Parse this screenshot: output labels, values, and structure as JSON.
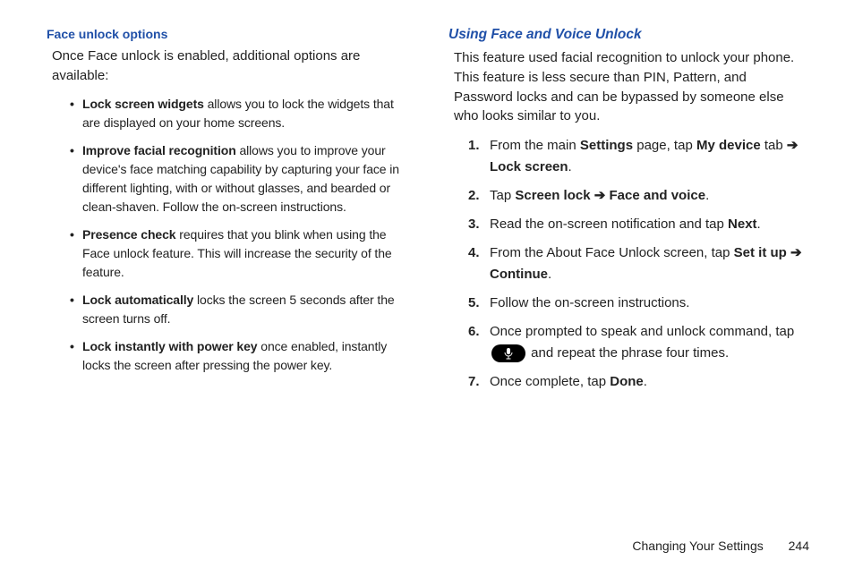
{
  "left": {
    "heading": "Face unlock options",
    "intro": "Once Face unlock is enabled, additional options are available:",
    "bullets": [
      {
        "bold": "Lock screen widgets",
        "rest": " allows you to lock the widgets that are displayed on your home screens."
      },
      {
        "bold": "Improve facial recognition",
        "rest": " allows you to improve your device's face matching capability by capturing your face in different lighting, with or without glasses, and bearded or clean-shaven. Follow the on-screen instructions."
      },
      {
        "bold": "Presence check",
        "rest": " requires that you blink when using the Face unlock feature. This will increase the security of the feature."
      },
      {
        "bold": "Lock automatically",
        "rest": " locks the screen 5 seconds after the screen turns off."
      },
      {
        "bold": "Lock instantly with power key",
        "rest": " once enabled, instantly locks the screen after pressing the power key."
      }
    ]
  },
  "right": {
    "heading": "Using Face and Voice Unlock",
    "intro": "This feature used facial recognition to unlock your phone. This feature is less secure than PIN, Pattern, and Password locks and can be bypassed by someone else who looks similar to you.",
    "steps": {
      "s1a": "From the main ",
      "s1b": "Settings",
      "s1c": " page, tap ",
      "s1d": "My device",
      "s1e": " tab ",
      "arrow": "➔",
      "s1f": "Lock screen",
      "s1g": ".",
      "s2a": "Tap ",
      "s2b": "Screen lock",
      "s2c": " ",
      "s2d": "Face and voice",
      "s2e": ".",
      "s3a": "Read the on-screen notification and tap ",
      "s3b": "Next",
      "s3c": ".",
      "s4a": "From the About Face Unlock screen, tap ",
      "s4b": "Set it up",
      "s4c": " ",
      "s4d": "Continue",
      "s4e": ".",
      "s5": "Follow the on-screen instructions.",
      "s6a": "Once prompted to speak and unlock command, tap ",
      "s6b": " and repeat the phrase four times.",
      "s7a": "Once complete, tap ",
      "s7b": "Done",
      "s7c": "."
    },
    "nums": {
      "n1": "1.",
      "n2": "2.",
      "n3": "3.",
      "n4": "4.",
      "n5": "5.",
      "n6": "6.",
      "n7": "7."
    }
  },
  "footer": {
    "section": "Changing Your Settings",
    "page": "244"
  }
}
